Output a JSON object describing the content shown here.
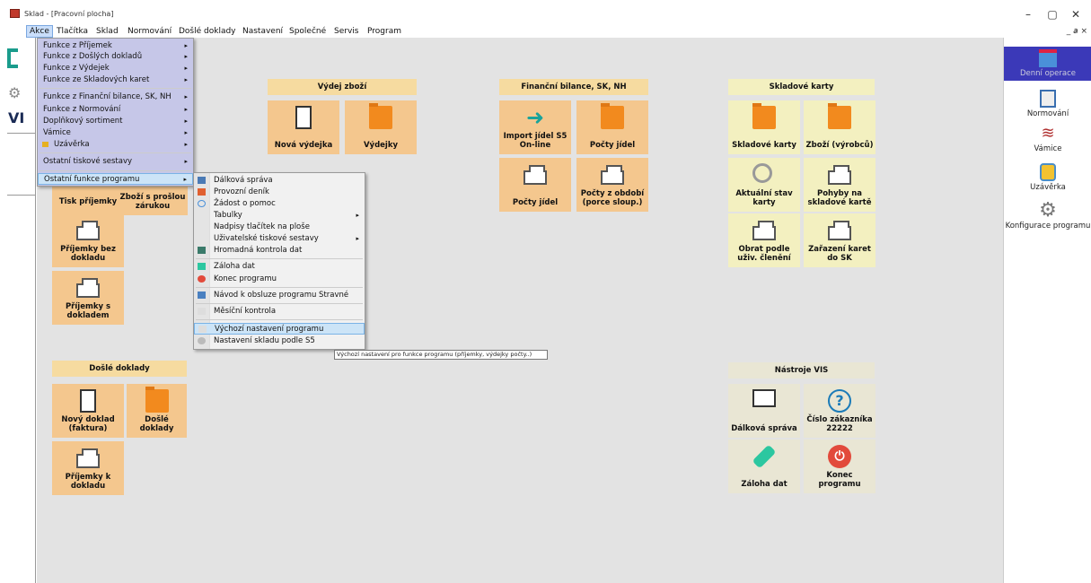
{
  "window": {
    "title": "Sklad - [Pracovní plocha]",
    "controls": [
      "–",
      "▢",
      "✕"
    ],
    "mdi_controls": "_ 𝘢 ×"
  },
  "menubar": {
    "items": [
      "Akce",
      "Tlačítka",
      "Sklad",
      "Normování",
      "Došlé doklady",
      "Nastavení",
      "Společné",
      "Servis",
      "Program"
    ]
  },
  "menu_akce": {
    "items": [
      "Funkce z Příjemek",
      "Funkce z Došlých dokladů",
      "Funkce z Výdejek",
      "Funkce ze Skladových karet",
      "Funkce z Finanční bilance, SK, NH",
      "Funkce z Normování",
      "Doplňkový sortiment",
      "Vámice",
      "Uzávěrka",
      "Ostatní tiskové sestavy",
      "Ostatní funkce programu"
    ]
  },
  "menu_ostatni": {
    "items": [
      "Dálková správa",
      "Provozní deník",
      "Žádost o pomoc",
      "Tabulky",
      "Nadpisy tlačítek na ploše",
      "Uživatelské tiskové sestavy",
      "Hromadná kontrola dat",
      "Záloha dat",
      "Konec programu",
      "Návod k obsluze programu Stravné",
      "Měsíční kontrola",
      "Výchozí nastavení programu",
      "Nastavení skladu podle S5"
    ]
  },
  "tooltip": "Výchozí nastavení pro funkce programu (příjemky, výdejky počty..)",
  "sections": {
    "vydej": {
      "title": "Výdej zboží",
      "tiles": [
        "Nová výdejka",
        "Výdejky"
      ]
    },
    "financni": {
      "title": "Finanční bilance, SK, NH",
      "tiles": [
        "Import jídel S5 On-line",
        "Počty jídel",
        "Počty jídel",
        "Počty z období (porce sloup.)"
      ]
    },
    "karty": {
      "title": "Skladové karty",
      "tiles": [
        "Skladové karty",
        "Zboží (výrobců)",
        "Aktuální stav karty",
        "Pohyby na skladové kartě",
        "Obrat podle uživ. členění",
        "Zařazení karet do SK"
      ]
    },
    "prijemky": {
      "tiles": [
        "Tisk příjemky",
        "Zboží s prošlou zárukou",
        "Příjemky bez dokladu",
        "Příjemky s dokladem"
      ]
    },
    "doslé": {
      "title": "Došlé doklady",
      "tiles": [
        "Nový doklad (faktura)",
        "Došlé doklady",
        "Příjemky k dokladu"
      ]
    },
    "nastroje": {
      "title": "Nástroje VIS",
      "tiles": [
        "Dálková správa",
        "Číslo zákazníka 22222",
        "Záloha dat",
        "Konec programu"
      ]
    }
  },
  "sidebar": {
    "items": [
      "Denní operace",
      "Normování",
      "Vámice",
      "Uzávěrka",
      "Konfigurace programu"
    ]
  },
  "left": {
    "vi": "VI"
  },
  "colors": {
    "tile_orange": "#f4c78e",
    "tile_yellow": "#f3f0c0",
    "menu_bg": "#c6c7e8",
    "sidebar_selected": "#3b39b8"
  }
}
